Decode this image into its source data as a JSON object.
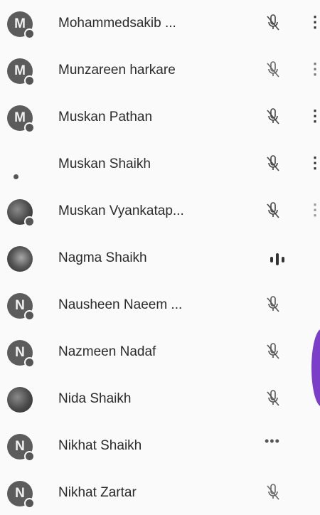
{
  "participants": [
    {
      "name": "Mohammedsakib ...",
      "initial": "M",
      "avatar": "letter",
      "status": "muted",
      "menu": true
    },
    {
      "name": "Munzareen harkare",
      "initial": "M",
      "avatar": "letter",
      "status": "muted",
      "menu": true
    },
    {
      "name": "Muskan Pathan",
      "initial": "M",
      "avatar": "letter",
      "status": "muted",
      "menu": true
    },
    {
      "name": "Muskan Shaikh",
      "initial": "",
      "avatar": "none",
      "status": "muted",
      "menu": true
    },
    {
      "name": "Muskan Vyankatap...",
      "initial": "",
      "avatar": "photo",
      "status": "muted",
      "menu": true
    },
    {
      "name": "Nagma Shaikh",
      "initial": "",
      "avatar": "photo",
      "status": "speaking",
      "menu": false
    },
    {
      "name": "Nausheen Naeem ...",
      "initial": "N",
      "avatar": "letter",
      "status": "muted",
      "menu": false
    },
    {
      "name": "Nazmeen Nadaf",
      "initial": "N",
      "avatar": "letter",
      "status": "muted",
      "menu": false
    },
    {
      "name": "Nida Shaikh",
      "initial": "",
      "avatar": "photo",
      "status": "muted",
      "menu": false
    },
    {
      "name": "Nikhat Shaikh",
      "initial": "N",
      "avatar": "letter",
      "status": "more",
      "menu": false
    },
    {
      "name": "Nikhat Zartar",
      "initial": "N",
      "avatar": "letter",
      "status": "muted",
      "menu": false
    }
  ],
  "icons": {
    "muted": "mic-off-icon",
    "speaking": "audio-bars-icon",
    "more": "more-horizontal-icon",
    "menu": "more-vertical-icon"
  },
  "colors": {
    "avatar": "#5c5c5c",
    "accent": "#7a3ec9"
  }
}
